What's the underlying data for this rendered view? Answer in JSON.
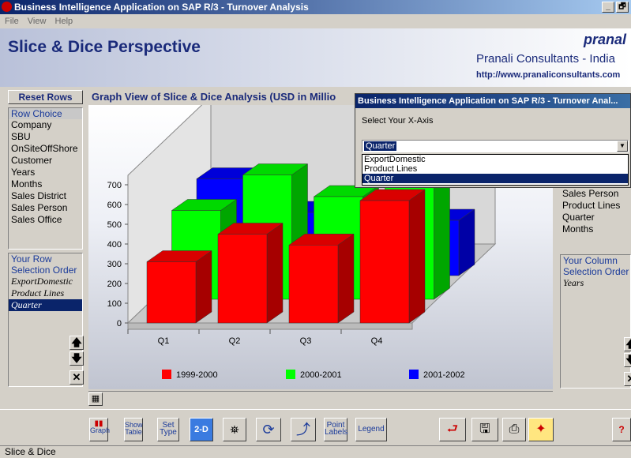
{
  "window": {
    "title": "Business Intelligence Application on SAP R/3 - Turnover Analysis",
    "minimize": "_",
    "maximize": "🗗"
  },
  "menu": [
    "File",
    "View",
    "Help"
  ],
  "header": {
    "title": "Slice & Dice Perspective",
    "brand": "pranal",
    "company": "Pranali Consultants - India",
    "url": "http://www.pranaliconsultants.com"
  },
  "left": {
    "reset_label": "Reset Rows",
    "row_choice_heading": "Row Choice",
    "row_choices": [
      "Company",
      "SBU",
      "OnSiteOffShore",
      "Customer",
      "Years",
      "Months",
      "Sales District",
      "Sales Person",
      "Sales Office"
    ],
    "row_order_heading": "Your Row Selection Order",
    "row_order": [
      "ExportDomestic",
      "Product Lines",
      "Quarter"
    ],
    "up_label": "🡅",
    "down_label": "🡇",
    "clear_label": "✕"
  },
  "graph": {
    "title": "Graph View of Slice & Dice Analysis (USD in Millio"
  },
  "chart_data": {
    "type": "bar",
    "title": "",
    "categories": [
      "Q1",
      "Q2",
      "Q3",
      "Q4"
    ],
    "yticks": [
      0,
      100,
      200,
      300,
      400,
      500,
      600,
      700
    ],
    "ylim": [
      0,
      700
    ],
    "series": [
      {
        "name": "1999-2000",
        "color": "#ff0000",
        "values": [
          310,
          450,
          395,
          620
        ]
      },
      {
        "name": "2000-2001",
        "color": "#00ff00",
        "values": [
          450,
          630,
          520,
          610
        ]
      },
      {
        "name": "2001-2002",
        "color": "#0000ff",
        "values": [
          490,
          320,
          300,
          280
        ]
      }
    ],
    "legend": "bottom",
    "grid": false
  },
  "dialog": {
    "title": "Business Intelligence Application on SAP R/3 - Turnover Anal...",
    "label": "Select Your X-Axis",
    "selected": "Quarter",
    "options": [
      "ExportDomestic",
      "Product Lines",
      "Quarter"
    ]
  },
  "right": {
    "col_choices": [
      "Sales Person",
      "Product Lines",
      "Quarter",
      "Months"
    ],
    "col_order_heading": "Your Column Selection Order",
    "col_order": [
      "Years"
    ],
    "up_label": "🡅",
    "down_label": "🡇",
    "clear_label": "✕"
  },
  "toolbar": {
    "graph": "Graph",
    "show_table": "Show Table",
    "set_type": "Set Type",
    "two_d": "2-D",
    "point_labels": "Point Labels",
    "legend": "Legend",
    "help": "?"
  },
  "status": "Slice & Dice"
}
